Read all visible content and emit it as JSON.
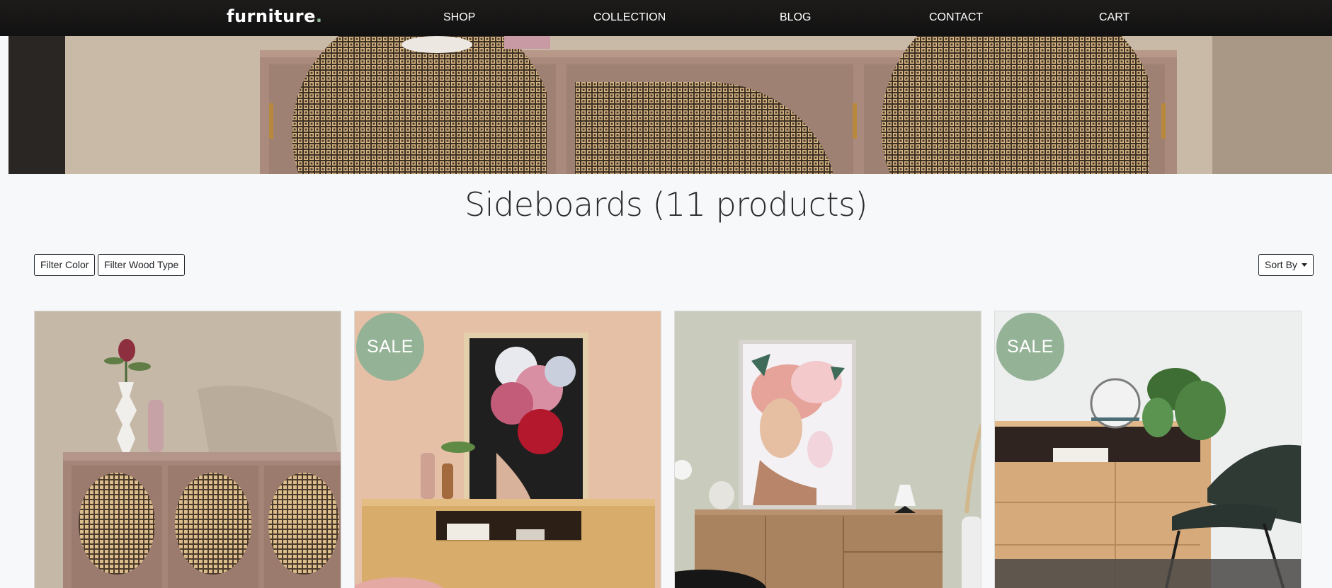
{
  "nav": {
    "brand": "furniture",
    "brand_dot": ".",
    "links": [
      "SHOP",
      "COLLECTION",
      "BLOG",
      "CONTACT",
      "CART"
    ]
  },
  "page": {
    "title": "Sideboards (11 products)"
  },
  "filters": {
    "color": "Filter Color",
    "wood": "Filter Wood Type",
    "sort": "Sort By"
  },
  "products": [
    {
      "badge": ""
    },
    {
      "badge": "SALE"
    },
    {
      "badge": ""
    },
    {
      "badge": "SALE"
    }
  ],
  "colors": {
    "nav_bg": "#161514",
    "accent": "#94b396",
    "page_bg": "#f7f8fa"
  }
}
